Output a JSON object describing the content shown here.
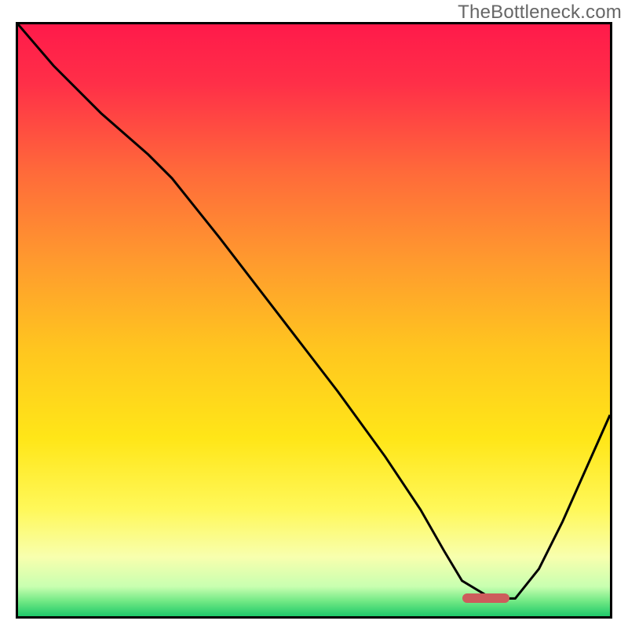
{
  "watermark": "TheBottleneck.com",
  "colors": {
    "gradient_stops": [
      {
        "offset": 0.0,
        "color": "#ff1a4a"
      },
      {
        "offset": 0.1,
        "color": "#ff2f48"
      },
      {
        "offset": 0.25,
        "color": "#ff6a3a"
      },
      {
        "offset": 0.4,
        "color": "#ff9a2e"
      },
      {
        "offset": 0.55,
        "color": "#ffc61f"
      },
      {
        "offset": 0.7,
        "color": "#ffe618"
      },
      {
        "offset": 0.82,
        "color": "#fff85a"
      },
      {
        "offset": 0.9,
        "color": "#f8ffae"
      },
      {
        "offset": 0.95,
        "color": "#c8ffb0"
      },
      {
        "offset": 0.975,
        "color": "#70e884"
      },
      {
        "offset": 1.0,
        "color": "#1fc96a"
      }
    ],
    "curve": "#000000",
    "marker": "#cd5c5c",
    "border": "#000000"
  },
  "chart_data": {
    "type": "line",
    "title": "",
    "xlabel": "",
    "ylabel": "",
    "xlim": [
      0,
      100
    ],
    "ylim": [
      0,
      100
    ],
    "grid": false,
    "series": [
      {
        "name": "bottleneck-curve",
        "x": [
          0,
          6,
          14,
          22,
          26,
          34,
          44,
          54,
          62,
          68,
          72,
          75,
          80,
          84,
          88,
          92,
          96,
          100
        ],
        "y": [
          100,
          93,
          85,
          78,
          74,
          64,
          51,
          38,
          27,
          18,
          11,
          6,
          3,
          3,
          8,
          16,
          25,
          34
        ]
      }
    ],
    "annotations": [
      {
        "type": "marker",
        "name": "optimal-range",
        "x_start": 75,
        "x_end": 83,
        "y": 3
      }
    ]
  }
}
